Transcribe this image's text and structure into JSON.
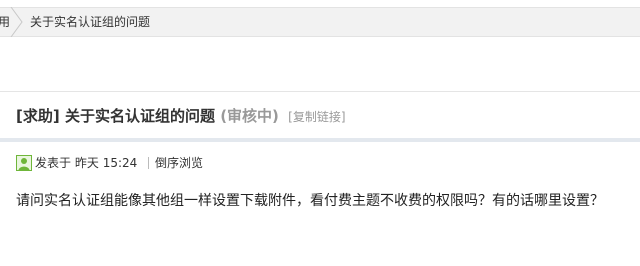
{
  "breadcrumb": {
    "parent_label": "用",
    "current_label": "关于实名认证组的问题"
  },
  "post": {
    "tag": "[求助]",
    "title": "关于实名认证组的问题",
    "status": "(审核中)",
    "copy_link_label": "[复制链接]",
    "meta": {
      "posted_label": "发表于",
      "posted_day": "昨天",
      "posted_time": "15:24",
      "order_label": "倒序浏览"
    },
    "content": "请问实名认证组能像其他组一样设置下载附件，看付费主题不收费的权限吗？有的话哪里设置？"
  },
  "colors": {
    "breadcrumb_bg": "#f2f2f2",
    "status_gray": "#999999",
    "user_icon_green": "#6fb63a",
    "divider_band": "#e3e8ee"
  },
  "icons": {
    "breadcrumb_separator": "chevron-separator-icon",
    "author_avatar": "user-icon"
  }
}
